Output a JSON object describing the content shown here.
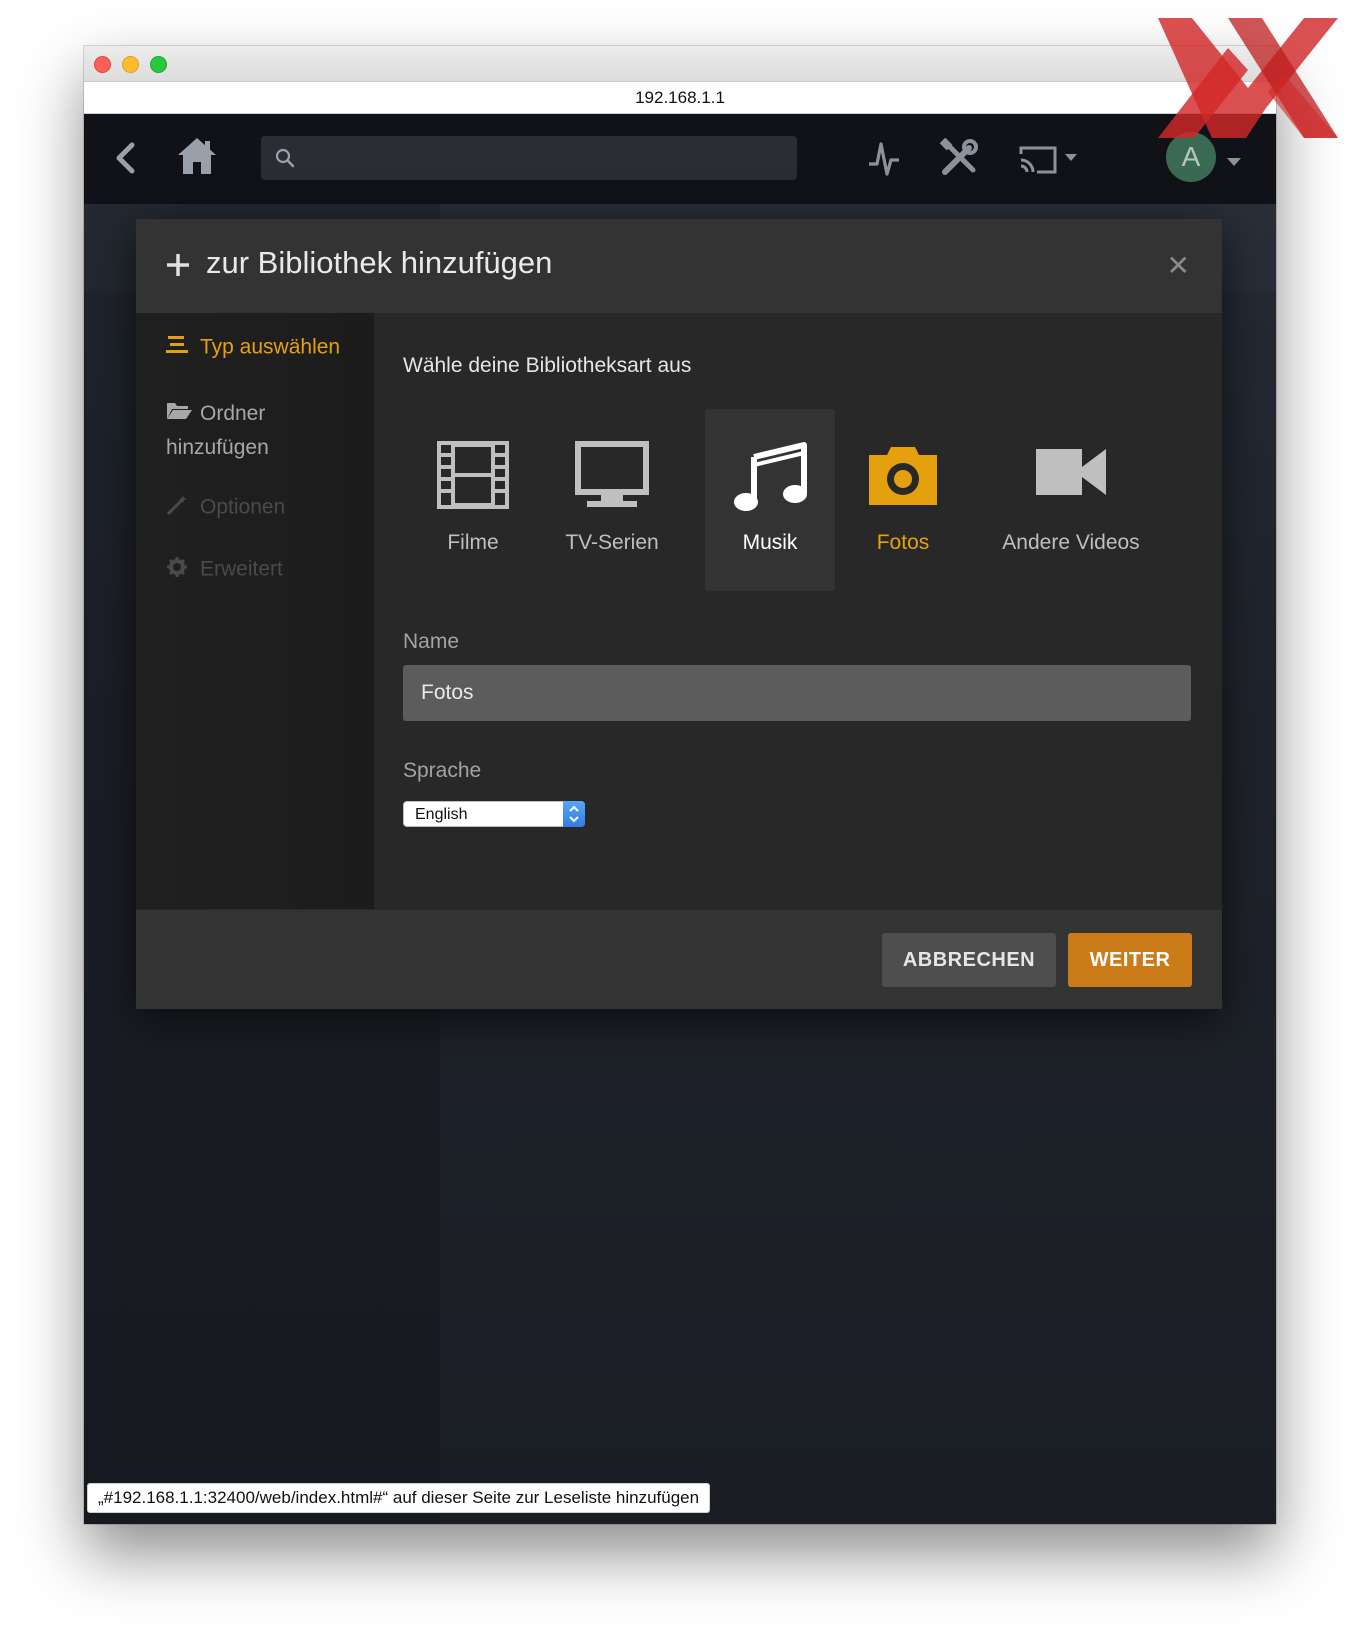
{
  "browser": {
    "address": "192.168.1.1",
    "status_text": "„#192.168.1.1:32400/web/index.html#“ auf dieser Seite zur Leseliste hinzufügen"
  },
  "topbar": {
    "avatar_letter": "A",
    "search_placeholder": ""
  },
  "modal": {
    "title": "zur Bibliothek hinzufügen",
    "steps": [
      {
        "label": "Typ auswählen",
        "icon": "list-icon",
        "state": "active"
      },
      {
        "label_line1": "Ordner",
        "label_line2": "hinzufügen",
        "icon": "folder-icon",
        "state": "enabled"
      },
      {
        "label": "Optionen",
        "icon": "magic-wand-icon",
        "state": "disabled"
      },
      {
        "label": "Erweitert",
        "icon": "gear-icon",
        "state": "disabled"
      }
    ],
    "section_label": "Wähle deine Bibliotheksart aus",
    "types": [
      {
        "label": "Filme",
        "icon": "film-icon"
      },
      {
        "label": "TV-Serien",
        "icon": "monitor-icon"
      },
      {
        "label": "Musik",
        "icon": "music-note-icon",
        "hover": true
      },
      {
        "label": "Fotos",
        "icon": "camera-icon",
        "selected": true
      },
      {
        "label": "Andere Videos",
        "icon": "video-camera-icon"
      }
    ],
    "name_label": "Name",
    "name_value": "Fotos",
    "language_label": "Sprache",
    "language_value": "English",
    "cancel_label": "ABBRECHEN",
    "next_label": "WEITER"
  },
  "colors": {
    "accent": "#e5a00d",
    "primary_button": "#cc7b19",
    "secondary_button": "#4e4e4e",
    "modal_bg": "#282828"
  }
}
